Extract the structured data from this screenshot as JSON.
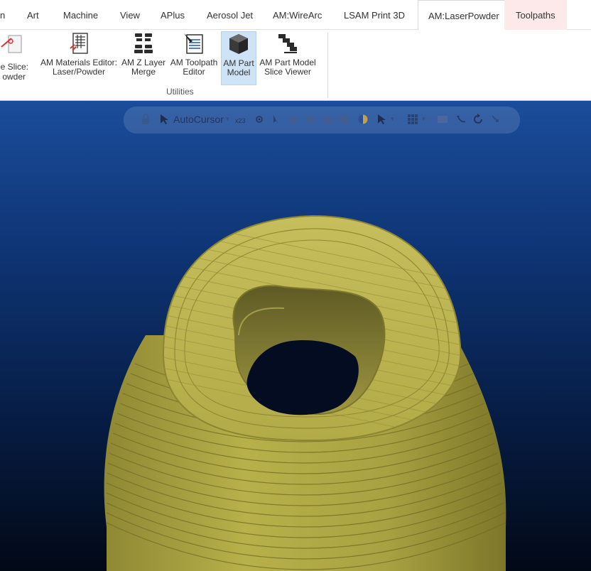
{
  "tabs": [
    {
      "label": "n"
    },
    {
      "label": "Art"
    },
    {
      "label": "Machine"
    },
    {
      "label": "View"
    },
    {
      "label": "APlus"
    },
    {
      "label": "Aerosol Jet"
    },
    {
      "label": "AM:WireArc"
    },
    {
      "label": "LSAM Print 3D"
    },
    {
      "label": "AM:LaserPowder"
    },
    {
      "label": "Toolpaths"
    }
  ],
  "ribbon": {
    "buttons": [
      {
        "line1": "ne Slice:",
        "line2": "owder",
        "icon": "slice-laser-icon"
      },
      {
        "line1": "AM Materials Editor:",
        "line2": "Laser/Powder",
        "icon": "materials-editor-icon"
      },
      {
        "line1": "AM Z Layer",
        "line2": "Merge",
        "icon": "layer-merge-icon"
      },
      {
        "line1": "AM Toolpath",
        "line2": "Editor",
        "icon": "toolpath-editor-icon"
      },
      {
        "line1": "AM Part",
        "line2": "Model",
        "icon": "part-model-icon"
      },
      {
        "line1": "AM Part Model",
        "line2": "Slice Viewer",
        "icon": "slice-viewer-icon"
      }
    ],
    "group_label": "Utilities"
  },
  "viewbar": {
    "autocursor_label": "AutoCursor",
    "icons": [
      "lock-icon",
      "cursor-icon",
      "xyz-snap-icon",
      "point-snap-icon",
      "select-arrow-icon",
      "view-front-icon",
      "view-top-icon",
      "view-right-icon",
      "view-iso-icon",
      "shaded-sphere-icon",
      "filter-icon",
      "grid-icon",
      "window-icon",
      "rotate-icon",
      "refresh-icon",
      "pan-icon"
    ]
  },
  "colors": {
    "part": "#b8b04a",
    "viewport_top": "#1b4d9a",
    "viewport_bottom": "#020916",
    "selected_button": "#cfe3f6"
  }
}
